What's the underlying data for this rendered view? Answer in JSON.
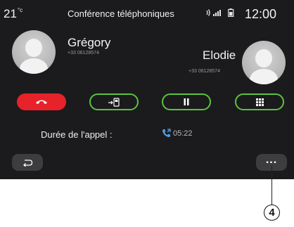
{
  "status_bar": {
    "temperature": "21",
    "temperature_unit": "°c",
    "title": "Conférence téléphoniques",
    "signal_icon": "signal-strength-icon",
    "battery_icon": "battery-icon",
    "time": "12:00"
  },
  "callers": [
    {
      "name": "Grégory",
      "number": "+33 06128574"
    },
    {
      "name": "Elodie",
      "number": "+33 06128574"
    }
  ],
  "actions": [
    {
      "icon": "hang-up-icon",
      "color": "#e8222a"
    },
    {
      "icon": "transfer-icon",
      "color": "#5cc33f"
    },
    {
      "icon": "pause-icon",
      "color": "#5cc33f"
    },
    {
      "icon": "keypad-icon",
      "color": "#5cc33f"
    }
  ],
  "duration": {
    "label": "Durée de l'appel :",
    "value": "05:22"
  },
  "footer": {
    "back_icon": "back-icon",
    "more_label": "..."
  },
  "annotation": {
    "callout_number": "4"
  }
}
